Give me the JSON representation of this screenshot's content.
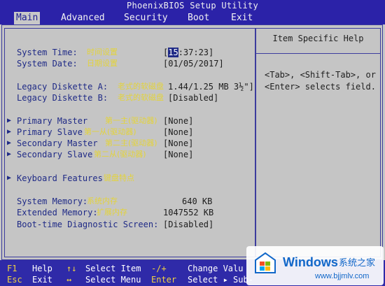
{
  "title": "PhoenixBIOS Setup Utility",
  "menu": [
    {
      "label": "Main",
      "active": true
    },
    {
      "label": "Advanced",
      "active": false
    },
    {
      "label": "Security",
      "active": false
    },
    {
      "label": "Boot",
      "active": false
    },
    {
      "label": "Exit",
      "active": false
    }
  ],
  "help": {
    "title": "Item Specific Help",
    "line1": "<Tab>, <Shift-Tab>, or",
    "line2": "<Enter> selects field."
  },
  "fields": {
    "system_time": {
      "label": "System Time:",
      "cn": "时间设置",
      "value_sel": "15",
      "value_rest": ":37:23]",
      "value_open": "["
    },
    "system_date": {
      "label": "System Date:",
      "cn": "日期设置",
      "value": "[01/05/2017]"
    },
    "legacy_a": {
      "label": "Legacy Diskette A:",
      "cn": "老式的软磁盘",
      "value": "1.44/1.25 MB  3½\"]"
    },
    "legacy_b": {
      "label": "Legacy Diskette B:",
      "cn": "老式的软磁盘",
      "value": "[Disabled]"
    },
    "primary_master": {
      "label": "Primary Master",
      "cn": "第一主(驱动器)",
      "value": "[None]"
    },
    "primary_slave": {
      "label": "Primary Slave",
      "cn": "第一从(驱动器)",
      "value": "[None]"
    },
    "secondary_master": {
      "label": "Secondary Master",
      "cn": "第二主(驱动器)",
      "value": "[None]"
    },
    "secondary_slave": {
      "label": "Secondary Slave",
      "cn": "第二从(驱动器)",
      "value": "[None]"
    },
    "keyboard": {
      "label": "Keyboard Features",
      "cn": "键盘特点"
    },
    "system_memory": {
      "label": "System Memory:",
      "cn": "系统内存",
      "value": "640 KB"
    },
    "extended_memory": {
      "label": "Extended Memory:",
      "cn": "扩展内存",
      "value": "1047552 KB"
    },
    "boot_diag": {
      "label": "Boot-time Diagnostic Screen:",
      "value": "[Disabled]"
    }
  },
  "bottom": {
    "f1": "F1",
    "help": "Help",
    "esc": "Esc",
    "exit": "Exit",
    "arrows_ud": "↑↓",
    "select_item": "Select Item",
    "arrows_lr": "↔",
    "select_menu": "Select Menu",
    "minus_plus": "-/+",
    "enter": "Enter",
    "change_values": "Change Valu",
    "select_sub": "Select ▸ Sub-"
  },
  "watermark": {
    "brand": "Windows",
    "cn": "系统之家",
    "url": "www.bjjmlv.com"
  }
}
